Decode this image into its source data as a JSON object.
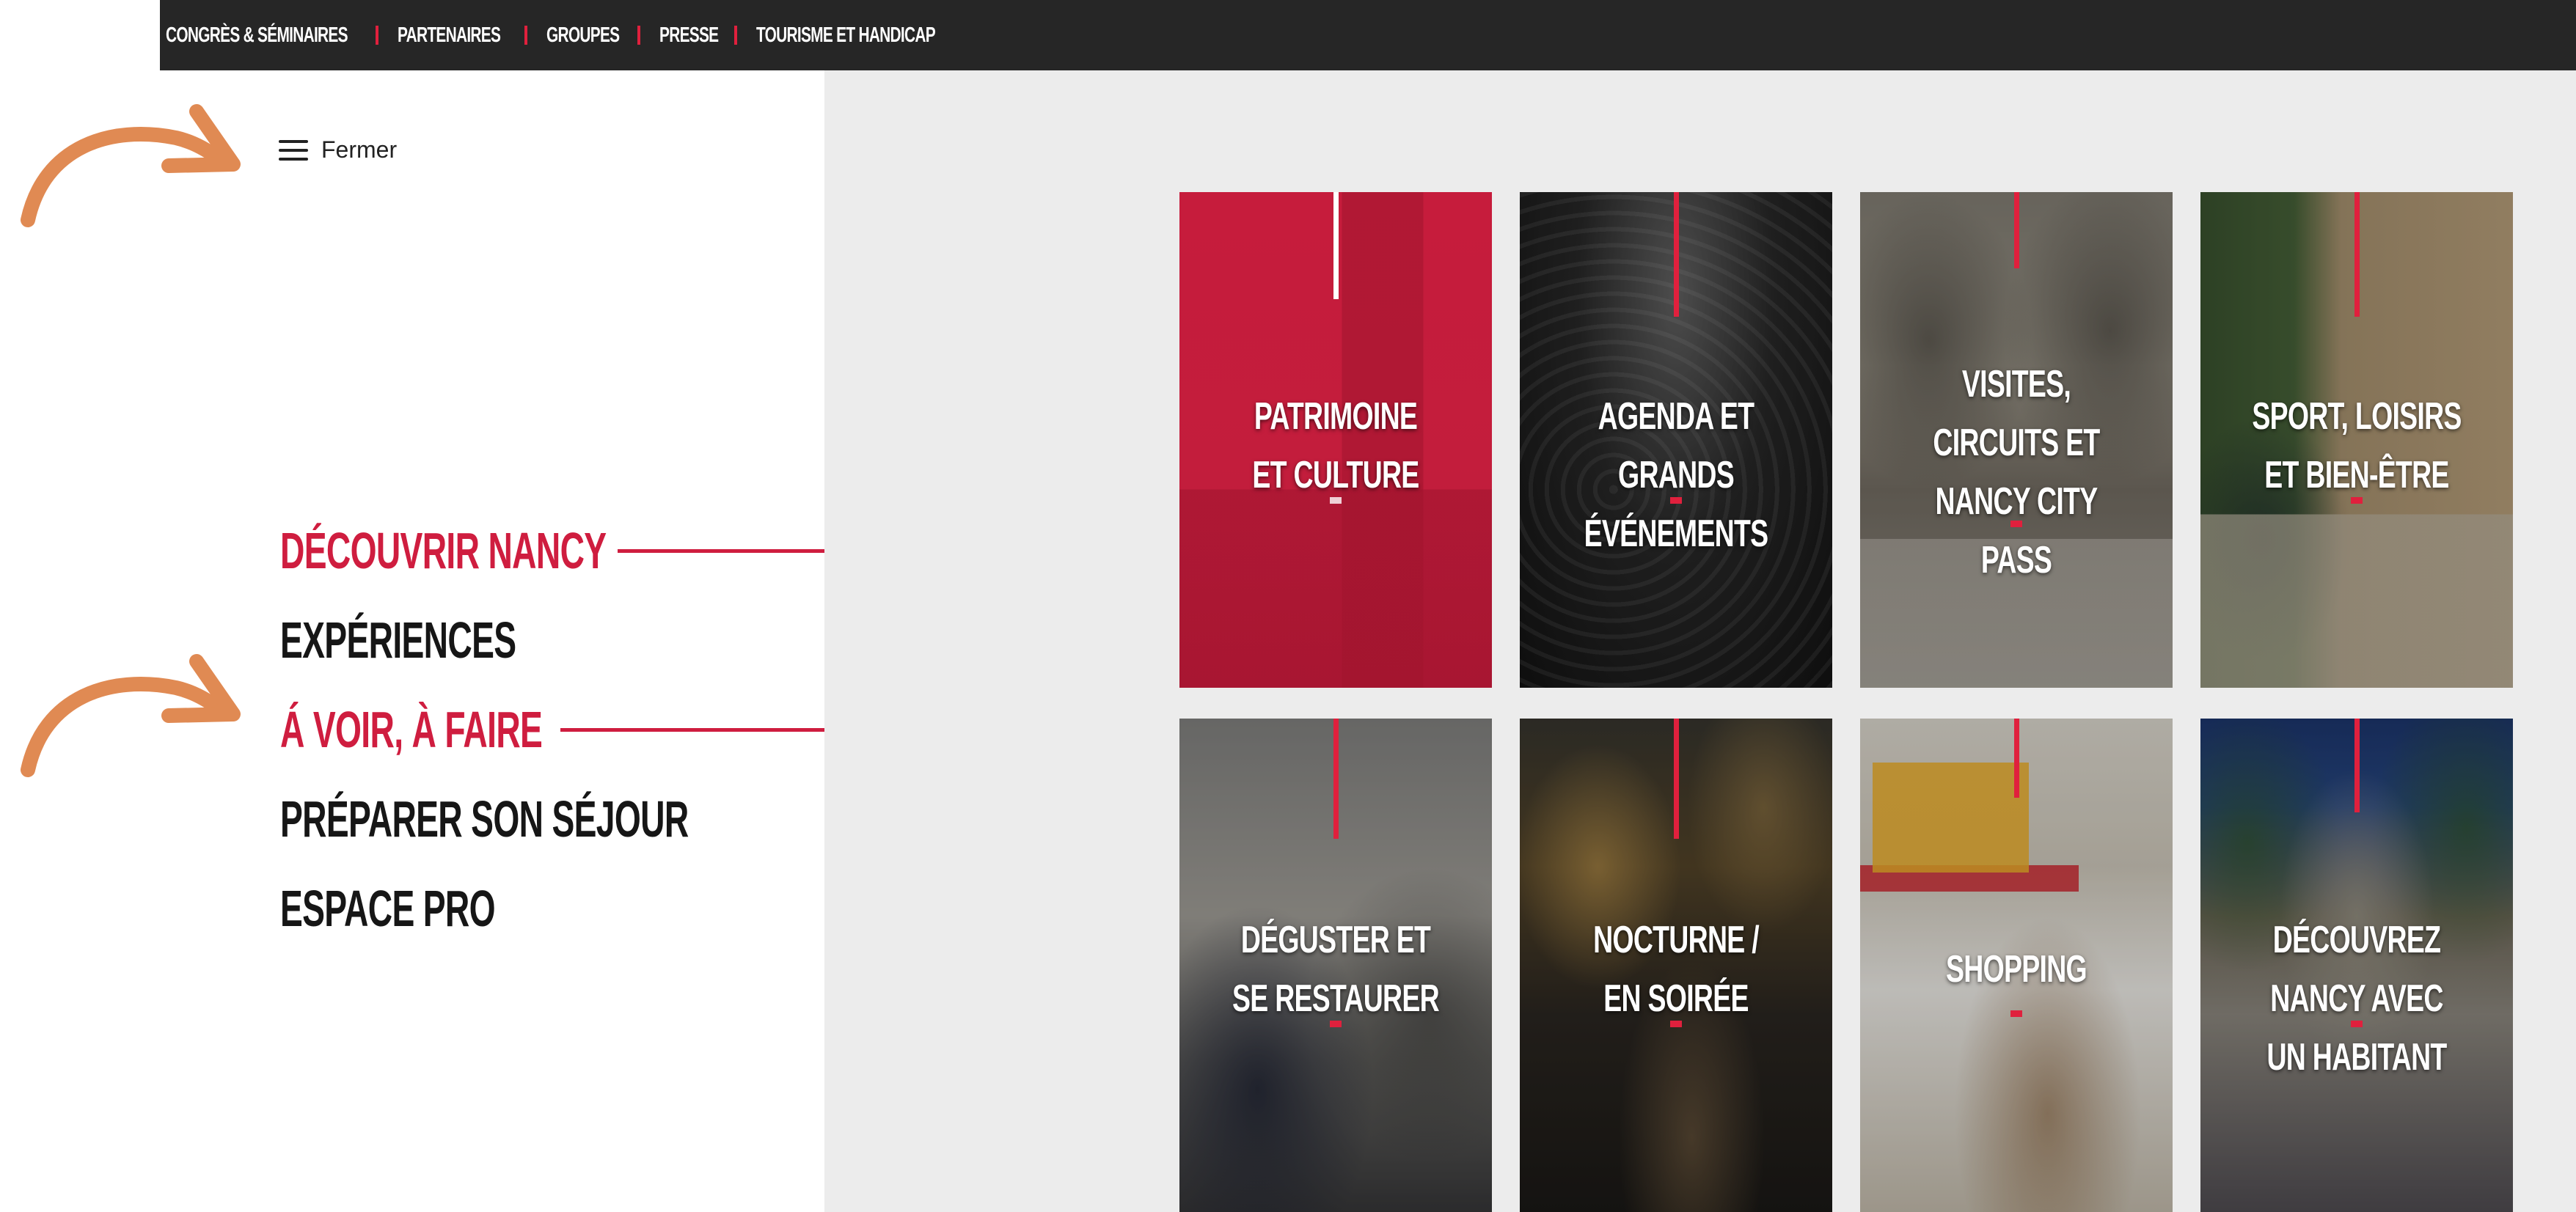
{
  "topbar": {
    "links": [
      {
        "label": "Congrès & séminaires"
      },
      {
        "label": "Partenaires"
      },
      {
        "label": "Groupes"
      },
      {
        "label": "Presse"
      },
      {
        "label": "Tourisme et handicap"
      }
    ],
    "separator_color": "#e0203d",
    "background": "#262626"
  },
  "menu_toggle": {
    "label": "Fermer",
    "icon": "hamburger-icon"
  },
  "menu": {
    "items": [
      {
        "label": "Découvrir Nancy",
        "active": true
      },
      {
        "label": "Expériences",
        "active": false
      },
      {
        "label": "Á voir, à faire",
        "active": true
      },
      {
        "label": "Préparer son séjour",
        "active": false
      },
      {
        "label": "Espace pro",
        "active": false
      }
    ],
    "accent_color": "#cf1d3f"
  },
  "tiles": [
    {
      "title": "Patrimoine et culture",
      "theme": "red-overlay"
    },
    {
      "title": "Agenda et grands événements",
      "theme": "concert-crowd-photo"
    },
    {
      "title": "Visites, circuits et Nancy City Pass",
      "theme": "old-town-gate-photo"
    },
    {
      "title": "Sport, loisirs et bien-être",
      "theme": "cyclist-photo"
    },
    {
      "title": "Déguster et se restaurer",
      "theme": "terrace-cafe-photo"
    },
    {
      "title": "Nocturne / en soirée",
      "theme": "night-street-photo"
    },
    {
      "title": "Shopping",
      "theme": "shop-interior-photo"
    },
    {
      "title": "Découvrez Nancy avec un habitant",
      "theme": "group-fountain-photo"
    }
  ],
  "annotations": {
    "arrow_color": "#e08a53",
    "icon": "curved-arrow-icon"
  }
}
